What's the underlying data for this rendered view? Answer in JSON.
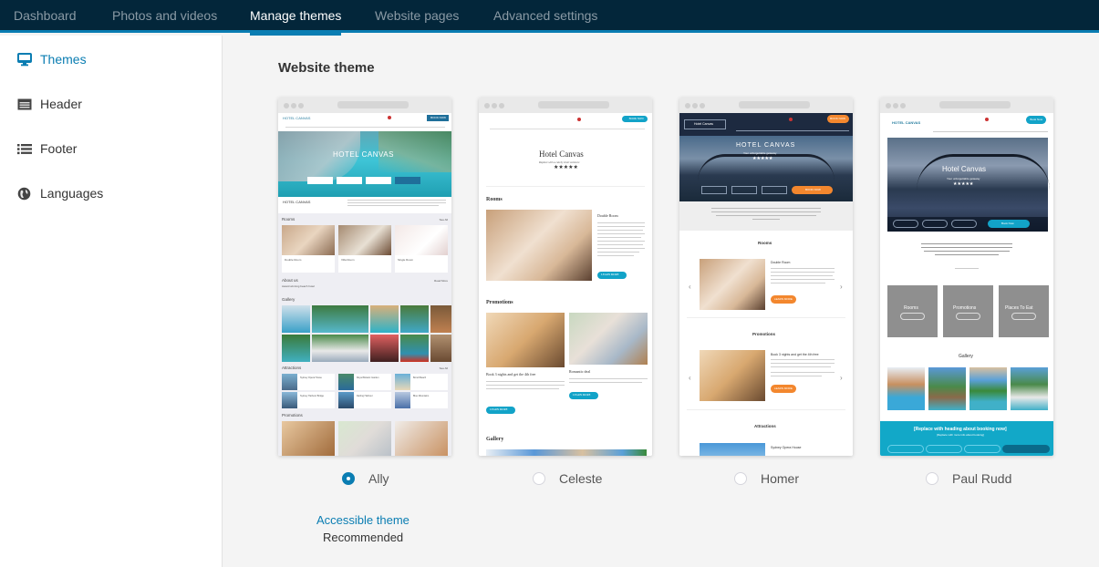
{
  "topnav": {
    "tabs": [
      {
        "label": "Dashboard",
        "active": false
      },
      {
        "label": "Photos and videos",
        "active": false
      },
      {
        "label": "Manage themes",
        "active": true
      },
      {
        "label": "Website pages",
        "active": false
      },
      {
        "label": "Advanced settings",
        "active": false
      }
    ]
  },
  "sidebar": {
    "items": [
      {
        "label": "Themes",
        "icon": "monitor-icon",
        "active": true
      },
      {
        "label": "Header",
        "icon": "header-icon",
        "active": false
      },
      {
        "label": "Footer",
        "icon": "list-icon",
        "active": false
      },
      {
        "label": "Languages",
        "icon": "globe-icon",
        "active": false
      }
    ]
  },
  "main": {
    "title": "Website theme",
    "accent_color": "#0a7db2",
    "themes": [
      {
        "name": "Ally",
        "selected": true,
        "note_link": "Accessible theme",
        "note": "Recommended",
        "preview": {
          "hotel_name": "HOTEL CANVAS",
          "book_button": "BOOK NOW",
          "sections": [
            "Rooms",
            "About us",
            "Gallery",
            "Attractions",
            "Promotions"
          ],
          "rooms": [
            "Double Room",
            "Villa Room",
            "Single Room"
          ],
          "see_all": "See All",
          "read_more": "Read More",
          "about_text": "Award winning beach hotel",
          "attractions": [
            "Sydney Opera House",
            "Royal Botanic Garden",
            "Bondi Beach",
            "Sydney Harbour Bridge",
            "Darling Harbour",
            "Blue Mountains"
          ]
        }
      },
      {
        "name": "Celeste",
        "selected": false,
        "preview": {
          "hotel_name": "Hotel Canvas",
          "tagline": "Replace with a catchy short sentence",
          "book_button": "BOOK NOW",
          "sections": [
            "Rooms",
            "Promotions",
            "Gallery"
          ],
          "room_title": "Double Room",
          "promos": [
            "Book 3 nights and get the 4th free",
            "Romantic deal"
          ],
          "learn_more": "LEARN MORE"
        }
      },
      {
        "name": "Homer",
        "selected": false,
        "preview": {
          "hotel_name": "HOTEL CANVAS",
          "logo_box": "Hotel Canvas",
          "tagline": "Your unforgettable getaway",
          "book_button": "BOOK NOW",
          "sections": [
            "Rooms",
            "Promotions",
            "Attractions"
          ],
          "room_title": "Double Room",
          "promo_title": "Book 3 nights and get the 4th free",
          "attraction_title": "Sydney Opera House",
          "learn_more": "LEARN MORE"
        }
      },
      {
        "name": "Paul Rudd",
        "selected": false,
        "preview": {
          "hotel_name": "Hotel Canvas",
          "logo": "HOTEL CANVAS",
          "tagline": "Your unforgettable getaway",
          "book_button": "Book Now",
          "tiles": [
            "Rooms",
            "Promotions",
            "Places To Eat"
          ],
          "tile_button": "Learn More",
          "gallery": "Gallery",
          "booking_heading": "[Replace with heading about booking now]",
          "booking_sub": "[Replace with more info about booking]"
        }
      }
    ]
  }
}
